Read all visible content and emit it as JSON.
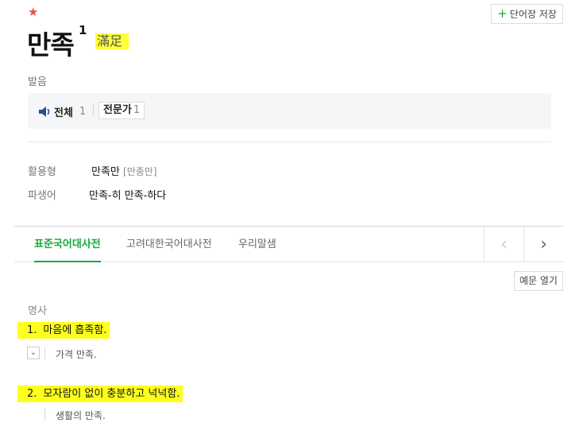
{
  "entry": {
    "star": "★",
    "word": "만족",
    "superscript": "1",
    "hanja": "滿足",
    "vocab_button": "단어장 저장",
    "vocab_button_icon": "+"
  },
  "pronunciation": {
    "label": "발음",
    "all_label": "전체",
    "all_count": "1",
    "expert_label": "전문가",
    "expert_count": "1",
    "speaker_icon": "speaker-icon"
  },
  "conjugation": {
    "label": "활용형",
    "value": "만족만",
    "pron": "[만종만]"
  },
  "derivatives": {
    "label": "파생어",
    "values": [
      "만족-히",
      "만족-하다"
    ]
  },
  "tabs": [
    {
      "label": "표준국어대사전",
      "active": true
    },
    {
      "label": "고려대한국어대사전",
      "active": false
    },
    {
      "label": "우리말샘",
      "active": false
    }
  ],
  "tab_nav": {
    "prev": "‹",
    "next": "›"
  },
  "examples_button": "예문 열기",
  "part_of_speech": "명사",
  "definitions": [
    {
      "num": "1.",
      "text": "마음에 흡족함.",
      "example": "가격 만족."
    },
    {
      "num": "2.",
      "text": "모자람이 없이 충분하고 넉넉함.",
      "example": "생활의 만족."
    }
  ],
  "colors": {
    "accent": "#19a83a",
    "highlight": "#ffff1e",
    "star": "#e8523f"
  }
}
